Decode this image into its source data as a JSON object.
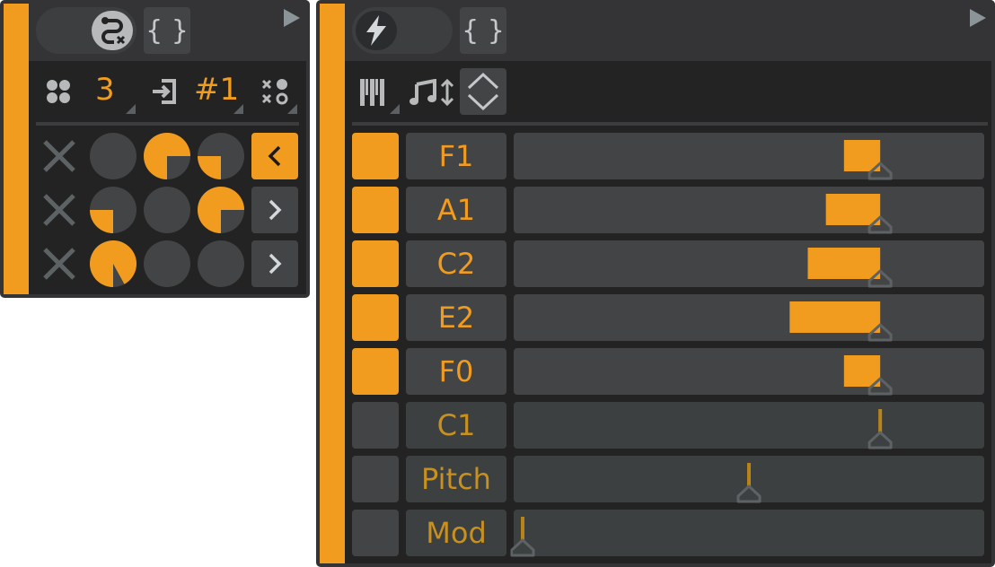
{
  "colors": {
    "accent": "#f19c1e",
    "accent_dim": "#c8901e",
    "marker_line": "#b8841a",
    "handle": "#5d6265"
  },
  "left_device": {
    "toggle_icon": "route-remove-icon",
    "brackets_label": "{ }",
    "play_icon": "play-triangle-icon",
    "toolbar": {
      "pattern_icon": "four-dots-icon",
      "count_value": "3",
      "input_icon": "input-arrow-icon",
      "slot_value": "#1",
      "pattern_mode_icon": "x-dot-grid-icon"
    },
    "grid": [
      {
        "row": 1,
        "cells": [
          0,
          0.75,
          0.25
        ],
        "nav": "<",
        "nav_active": true
      },
      {
        "row": 2,
        "cells": [
          0.25,
          0,
          0.75
        ],
        "nav": ">",
        "nav_active": false
      },
      {
        "row": 3,
        "cells": [
          0.92,
          0,
          0
        ],
        "nav": ">",
        "nav_active": false
      }
    ]
  },
  "right_device": {
    "toggle_icon": "lightning-bolt-icon",
    "brackets_label": "{ }",
    "play_icon": "play-triangle-icon",
    "toolbar": {
      "keys_icon": "piano-keys-icon",
      "note_range_icon": "note-updown-icon",
      "expand_icon": "chevron-updown-icon"
    },
    "rows": [
      {
        "label": "F1",
        "active": true,
        "position": 0.79,
        "amount": 0.08
      },
      {
        "label": "A1",
        "active": true,
        "position": 0.79,
        "amount": 0.12
      },
      {
        "label": "C2",
        "active": true,
        "position": 0.79,
        "amount": 0.16
      },
      {
        "label": "E2",
        "active": true,
        "position": 0.79,
        "amount": 0.2
      },
      {
        "label": "F0",
        "active": true,
        "position": 0.79,
        "amount": 0.08
      },
      {
        "label": "C1",
        "active": false,
        "position": 0.79,
        "amount": 0
      },
      {
        "label": "Pitch",
        "active": false,
        "position": 0.5,
        "amount": 0
      },
      {
        "label": "Mod",
        "active": false,
        "position": 0.0,
        "amount": 0
      }
    ]
  }
}
